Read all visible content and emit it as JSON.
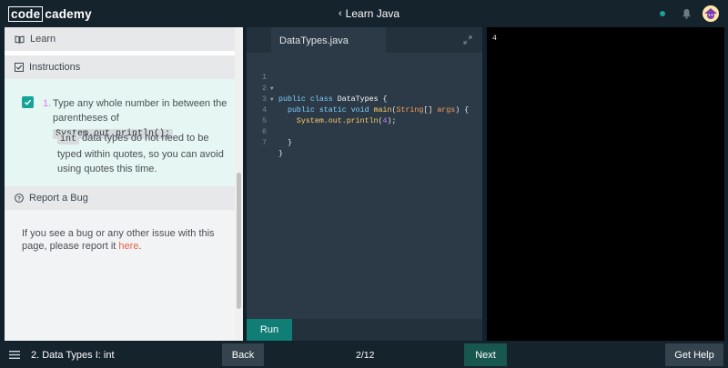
{
  "header": {
    "logo_box": "code",
    "logo_rest": "cademy",
    "course_back": "‹",
    "course_title": "Learn Java",
    "status_color": "#17a398"
  },
  "sidebar": {
    "learn_label": "Learn",
    "instructions_label": "Instructions",
    "task_number": "1.",
    "task_text_before": "Type any whole number in between the parentheses of",
    "task_code": "System.out.println();",
    "note_code": "int",
    "note_text": "data types do not need to be typed within quotes, so you can avoid using quotes this time.",
    "report_label": "Report a Bug",
    "report_text": "If you see a bug or any other issue with this page, please report it",
    "report_link": "here",
    "report_end": "."
  },
  "editor": {
    "tab_name": "DataTypes.java",
    "run_label": "Run",
    "lines": [
      {
        "n": "1",
        "fold": true
      },
      {
        "n": "2",
        "fold": true
      },
      {
        "n": "3",
        "fold": false
      },
      {
        "n": "4",
        "fold": false
      },
      {
        "n": "5",
        "fold": false
      },
      {
        "n": "6",
        "fold": false
      },
      {
        "n": "7",
        "fold": false
      }
    ]
  },
  "output": {
    "text": "4"
  },
  "footer": {
    "lesson_title": "2. Data Types I: int",
    "back_label": "Back",
    "progress": "2/12",
    "next_label": "Next",
    "help_label": "Get Help"
  },
  "colors": {
    "accent": "#17a398",
    "run_button": "#107e74",
    "next_button": "#18574f",
    "link": "#e8634a"
  }
}
